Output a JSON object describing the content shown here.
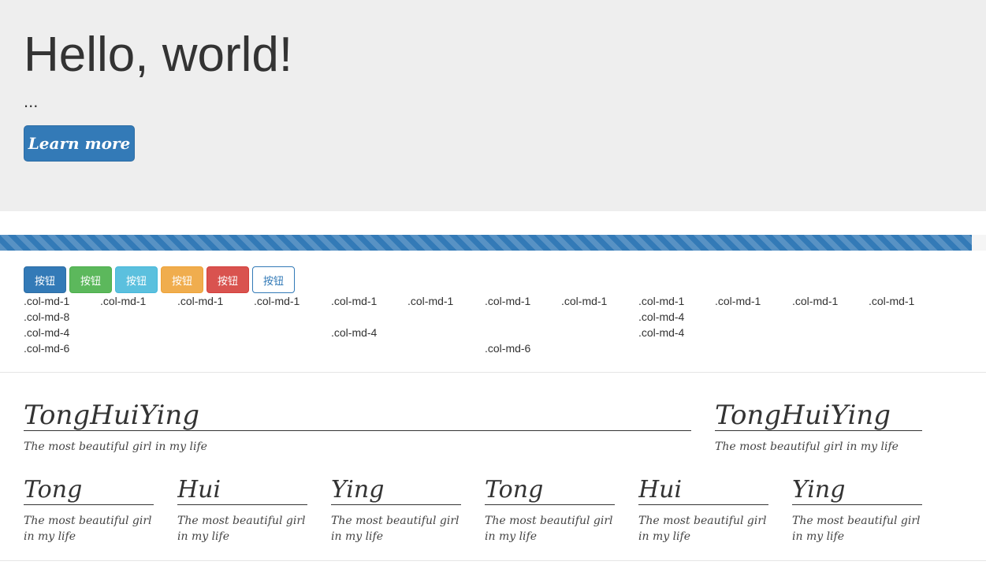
{
  "jumbotron": {
    "title": "Hello, world!",
    "text": "...",
    "button_label": "Learn more"
  },
  "progress": {
    "value_percent": 98.6
  },
  "buttons": [
    {
      "label": "按钮",
      "style": "primary"
    },
    {
      "label": "按钮",
      "style": "success"
    },
    {
      "label": "按钮",
      "style": "info"
    },
    {
      "label": "按钮",
      "style": "warning"
    },
    {
      "label": "按钮",
      "style": "danger"
    },
    {
      "label": "按钮",
      "style": "outline"
    }
  ],
  "grid": {
    "row1": [
      ".col-md-1",
      ".col-md-1",
      ".col-md-1",
      ".col-md-1",
      ".col-md-1",
      ".col-md-1",
      ".col-md-1",
      ".col-md-1",
      ".col-md-1",
      ".col-md-1",
      ".col-md-1",
      ".col-md-1"
    ],
    "row2": [
      ".col-md-8",
      ".col-md-4"
    ],
    "row3": [
      ".col-md-4",
      ".col-md-4",
      ".col-md-4"
    ],
    "row4": [
      ".col-md-6",
      ".col-md-6"
    ]
  },
  "profiles": {
    "large": [
      {
        "name": "TongHuiYing",
        "caption": "The most beautiful girl in my life"
      },
      {
        "name": "TongHuiYing",
        "caption": "The most beautiful girl in my life"
      }
    ],
    "small": [
      {
        "name": "Tong",
        "caption": "The most beautiful girl in my life"
      },
      {
        "name": "Hui",
        "caption": "The most beautiful girl in my life"
      },
      {
        "name": "Ying",
        "caption": "The most beautiful girl in my life"
      },
      {
        "name": "Tong",
        "caption": "The most beautiful girl in my life"
      },
      {
        "name": "Hui",
        "caption": "The most beautiful girl in my life"
      },
      {
        "name": "Ying",
        "caption": "The most beautiful girl in my life"
      }
    ]
  },
  "colors": {
    "primary": "#337ab7",
    "success": "#5cb85c",
    "info": "#5bc0de",
    "warning": "#f0ad4e",
    "danger": "#d9534f",
    "jumbotron_bg": "#eeeeee"
  }
}
